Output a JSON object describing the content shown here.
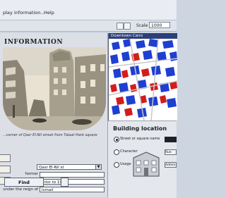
{
  "menubar": {
    "items": [
      "play information...",
      "Help"
    ]
  },
  "toolbar": {
    "scale_label": "Scale 1:",
    "scale_value": "1000"
  },
  "info_panel": {
    "title": "INFORMATION",
    "caption": "...corner of Qasr El-Nil street from Talaat Harb square",
    "select_value": "Qasr El-Nil st",
    "fields": [
      {
        "label": "former",
        "value": ""
      },
      {
        "label": "developed",
        "value": "prior to 1950"
      },
      {
        "label": "under the reign of",
        "value": "Ismail"
      }
    ]
  },
  "map_panel": {
    "title": "Downtown Cairo"
  },
  "building_location": {
    "title": "Building location",
    "options": [
      {
        "label": "Street or square name",
        "selected": true
      },
      {
        "label": "Character",
        "selected": false
      },
      {
        "label": "Usage",
        "selected": false
      }
    ],
    "combos": [
      "",
      "Rue El...",
      "Admin..."
    ],
    "find_label": "Find"
  }
}
